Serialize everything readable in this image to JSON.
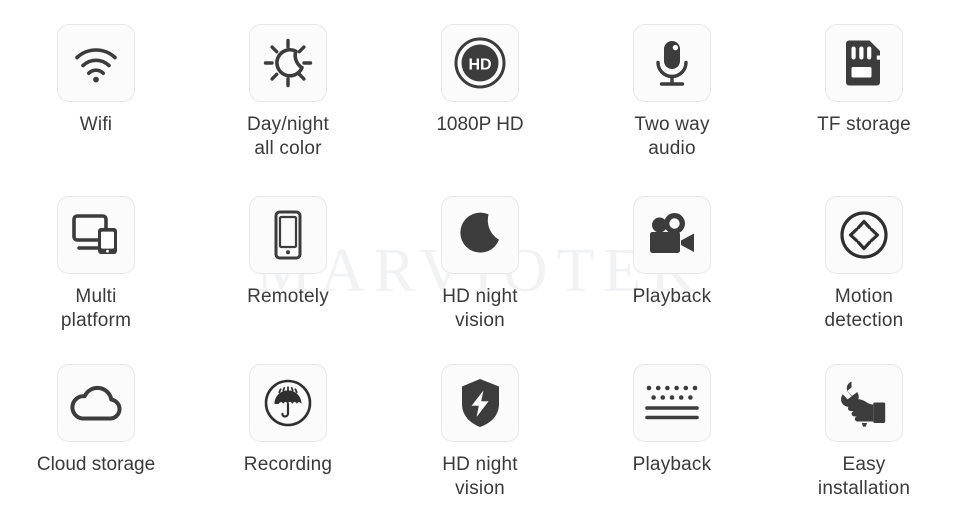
{
  "watermark": {
    "text": "MARVIOTEK",
    "color": "#f1f2f4"
  },
  "theme": {
    "icon_color": "#3c3c3c",
    "tile_border": "#e6e7e9",
    "tile_background": "#fbfbfc",
    "label_color": "#3a3a3a",
    "page_background": "#ffffff"
  },
  "features": [
    {
      "id": "wifi",
      "icon": "wifi-icon",
      "label": "Wifi"
    },
    {
      "id": "day-night",
      "icon": "moon-sun-icon",
      "label": "Day/night\nall color"
    },
    {
      "id": "1080p-hd",
      "icon": "hd-badge-icon",
      "label": "1080P HD"
    },
    {
      "id": "two-way-audio",
      "icon": "microphone-icon",
      "label": "Two way\naudio"
    },
    {
      "id": "tf-storage",
      "icon": "sd-card-icon",
      "label": "TF storage"
    },
    {
      "id": "multi-platform",
      "icon": "monitor-phone-icon",
      "label": "Multi\nplatform"
    },
    {
      "id": "remotely",
      "icon": "smartphone-icon",
      "label": "Remotely"
    },
    {
      "id": "hd-night-vision",
      "icon": "crescent-moon-icon",
      "label": "HD night\nvision"
    },
    {
      "id": "playback",
      "icon": "video-camera-icon",
      "label": "Playback"
    },
    {
      "id": "motion-detection",
      "icon": "four-arrows-circle-icon",
      "label": "Motion\ndetection"
    },
    {
      "id": "cloud-storage",
      "icon": "cloud-icon",
      "label": "Cloud storage"
    },
    {
      "id": "recording",
      "icon": "umbrella-circle-icon",
      "label": "Recording"
    },
    {
      "id": "hd-night-vision-2",
      "icon": "shield-bolt-icon",
      "label": "HD night\nvision"
    },
    {
      "id": "playback-2",
      "icon": "dots-lines-icon",
      "label": "Playback"
    },
    {
      "id": "easy-installation",
      "icon": "wrench-hand-icon",
      "label": "Easy\ninstallation"
    }
  ]
}
